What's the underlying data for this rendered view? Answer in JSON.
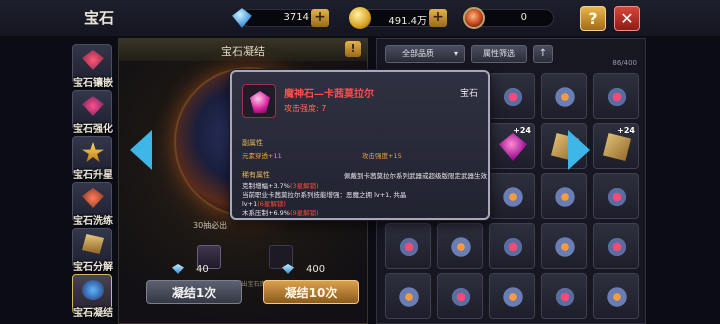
{
  "header": {
    "title": "宝石"
  },
  "resources": {
    "gems": "3714",
    "gold": "491.4万",
    "orb": "0"
  },
  "sidebar": {
    "items": [
      {
        "label": "宝石镶嵌",
        "active": false
      },
      {
        "label": "宝石强化",
        "active": false
      },
      {
        "label": "宝石升星",
        "active": false
      },
      {
        "label": "宝石洗练",
        "active": false
      },
      {
        "label": "宝石分解",
        "active": false
      },
      {
        "label": "宝石凝结",
        "active": true
      }
    ]
  },
  "left_panel": {
    "title": "宝石凝结",
    "pity_text": "30抽必出",
    "note": "凝出██级宝石后，有30%的概率凝出宝石库宝石",
    "single": {
      "cost": "40",
      "label": "凝结1次"
    },
    "ten": {
      "cost": "400",
      "label": "凝结10次"
    }
  },
  "right_panel": {
    "filter_quality": "全部品质",
    "filter_attr": "属性筛选",
    "sort_icon": "arrow-up-icon",
    "count": "86/400",
    "cells": [
      {
        "item": "it-wing",
        "tag": "",
        "badge": ""
      },
      {
        "item": "it-wing2",
        "tag": "",
        "badge": ""
      },
      {
        "item": "it-wing",
        "tag": "",
        "badge": ""
      },
      {
        "item": "it-wing2",
        "tag": "",
        "badge": ""
      },
      {
        "item": "it-wing",
        "tag": "",
        "badge": ""
      },
      {
        "item": "it-skull",
        "tag": "装备中",
        "badge": ""
      },
      {
        "item": "it-skull",
        "tag": "装备中",
        "badge": ""
      },
      {
        "item": "it-gem",
        "tag": "",
        "badge": "+24"
      },
      {
        "item": "it-scroll",
        "tag": "",
        "badge": ""
      },
      {
        "item": "it-scroll",
        "tag": "",
        "badge": "+24"
      },
      {
        "item": "it-scroll",
        "tag": "",
        "badge": ""
      },
      {
        "item": "it-scroll",
        "tag": "",
        "badge": "+24"
      },
      {
        "item": "it-wing2",
        "tag": "",
        "badge": ""
      },
      {
        "item": "it-wing2",
        "tag": "",
        "badge": ""
      },
      {
        "item": "it-wing",
        "tag": "",
        "badge": ""
      },
      {
        "item": "it-wing",
        "tag": "",
        "badge": ""
      },
      {
        "item": "it-wing2",
        "tag": "",
        "badge": ""
      },
      {
        "item": "it-wing",
        "tag": "",
        "badge": ""
      },
      {
        "item": "it-wing2",
        "tag": "",
        "badge": ""
      },
      {
        "item": "it-wing",
        "tag": "",
        "badge": ""
      },
      {
        "item": "it-wing2",
        "tag": "",
        "badge": ""
      },
      {
        "item": "it-wing",
        "tag": "",
        "badge": ""
      },
      {
        "item": "it-wing2",
        "tag": "",
        "badge": ""
      },
      {
        "item": "it-wing",
        "tag": "",
        "badge": ""
      },
      {
        "item": "it-wing2",
        "tag": "",
        "badge": ""
      }
    ]
  },
  "tooltip": {
    "name": "魔神石—卡茜莫拉尔",
    "type": "宝石",
    "attack": "攻击强度: 7",
    "secondary_title": "副属性",
    "secondary_left": "元素穿透+11",
    "secondary_right": "攻击强度+15",
    "rare_title": "稀有属性",
    "rare_desc": "佩戴到卡茜莫拉尔系列武器或超级版限定武器生效",
    "rare_1": "克制增幅+3.7%",
    "rare_1_lock": "(3星解锁)",
    "rare_2": "当前职业卡茜莫拉尔系列技能增强：恶魔之拥 lv+1, 共晶",
    "rare_3": "lv+1",
    "rare_3_lock": "(6星解锁)",
    "rare_4": "木系压制+6.9%",
    "rare_4_lock": "(9星解锁)"
  }
}
